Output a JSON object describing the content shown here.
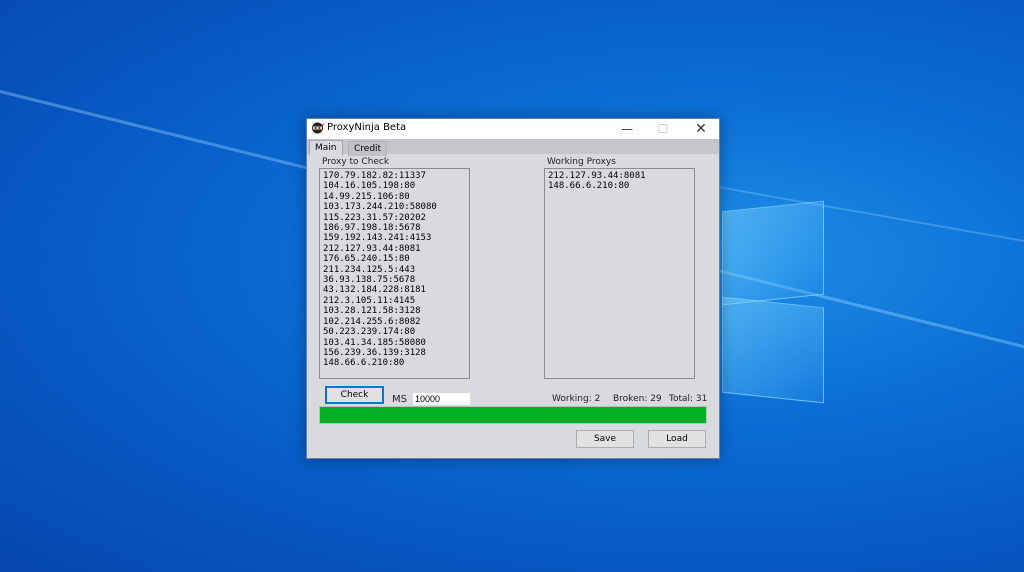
{
  "window": {
    "title": "ProxyNinja Beta",
    "min_glyph": "—",
    "max_glyph": "☐",
    "close_glyph": "✕"
  },
  "tabs": [
    {
      "label": "Main"
    },
    {
      "label": "Credit"
    }
  ],
  "proxy_check": {
    "label": "Proxy to Check",
    "items": [
      "170.79.182.82:11337",
      "104.16.105.198:80",
      "14.99.215.106:80",
      "103.173.244.210:58080",
      "115.223.31.57:20202",
      "186.97.198.18:5678",
      "159.192.143.241:4153",
      "212.127.93.44:8081",
      "176.65.240.15:80",
      "211.234.125.5:443",
      "36.93.138.75:5678",
      "43.132.184.228:8181",
      "212.3.105.11:4145",
      "103.28.121.58:3128",
      "102.214.255.6:8082",
      "50.223.239.174:80",
      "103.41.34.185:58080",
      "156.239.36.139:3128",
      "148.66.6.210:80"
    ]
  },
  "working": {
    "label": "Working Proxys",
    "items": [
      "212.127.93.44:8081",
      "148.66.6.210:80"
    ]
  },
  "controls": {
    "check_label": "Check",
    "ms_label": "MS",
    "ms_value": "10000",
    "working_stat": "Working: 2",
    "broken_stat": "Broken: 29",
    "total_stat": "Total: 31",
    "progress": 1.0,
    "progress_color": "#06b025",
    "save_label": "Save",
    "load_label": "Load"
  }
}
